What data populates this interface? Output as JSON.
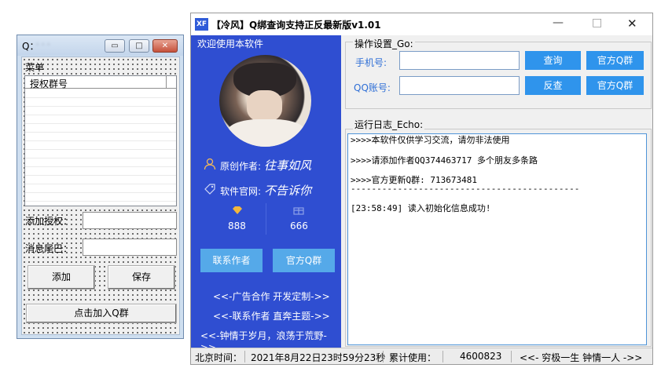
{
  "left_window": {
    "title": "Q：",
    "title_blurred": "·  ·  ·",
    "btn_min": "▭",
    "btn_max": "□",
    "btn_close": "✕",
    "menu": "菜单",
    "list_header": "授权群号",
    "add_auth_label": "添加授权：",
    "msg_tail_label": "消息尾巴：",
    "add_button": "添加",
    "save_button": "保存",
    "join_button": "点击加入Q群"
  },
  "right_window": {
    "logo": "XF",
    "title": "【冷风】Q绑查询支持正反最新版v1.01",
    "btn_min": "—",
    "btn_max": "□",
    "btn_close": "✕",
    "panel": {
      "welcome": "欢迎使用本软件",
      "author_label": "原创作者:",
      "author_name": "往事如风",
      "site_label": "软件官网:",
      "site_name": "不告诉你",
      "stat1": "888",
      "stat2": "666",
      "contact_button": "联系作者",
      "group_button": "官方Q群",
      "link1": "<<-广告合作 开发定制->>",
      "link2": "<<-联系作者 直奔主题->>",
      "link3": "<<-钟情于岁月，浪荡于荒野->>"
    },
    "ops": {
      "title": "操作设置_Go:",
      "phone_label": "手机号:",
      "qq_label": "QQ账号:",
      "phone_value": "",
      "qq_value": "",
      "query_button": "查询",
      "reverse_button": "反查",
      "official_group_1": "官方Q群",
      "official_group_2": "官方Q群"
    },
    "log": {
      "title": "运行日志_Echo:",
      "lines": [
        ">>>>本软件仅供学习交流，请勿非法使用",
        ">>>>请添加作者QQ374463717 多个朋友多条路",
        ">>>>官方更新Q群: 713673481",
        "--------------------------------------------",
        "",
        "[23:58:49]  读入初始化信息成功!"
      ]
    },
    "status": {
      "time_label": "北京时间：",
      "time_value": "2021年8月22日23时59分23秒",
      "usage_label": "累计使用：",
      "usage_value": "4600823",
      "slogan": "<<- 穷极一生 钟情一人 ->>"
    }
  }
}
